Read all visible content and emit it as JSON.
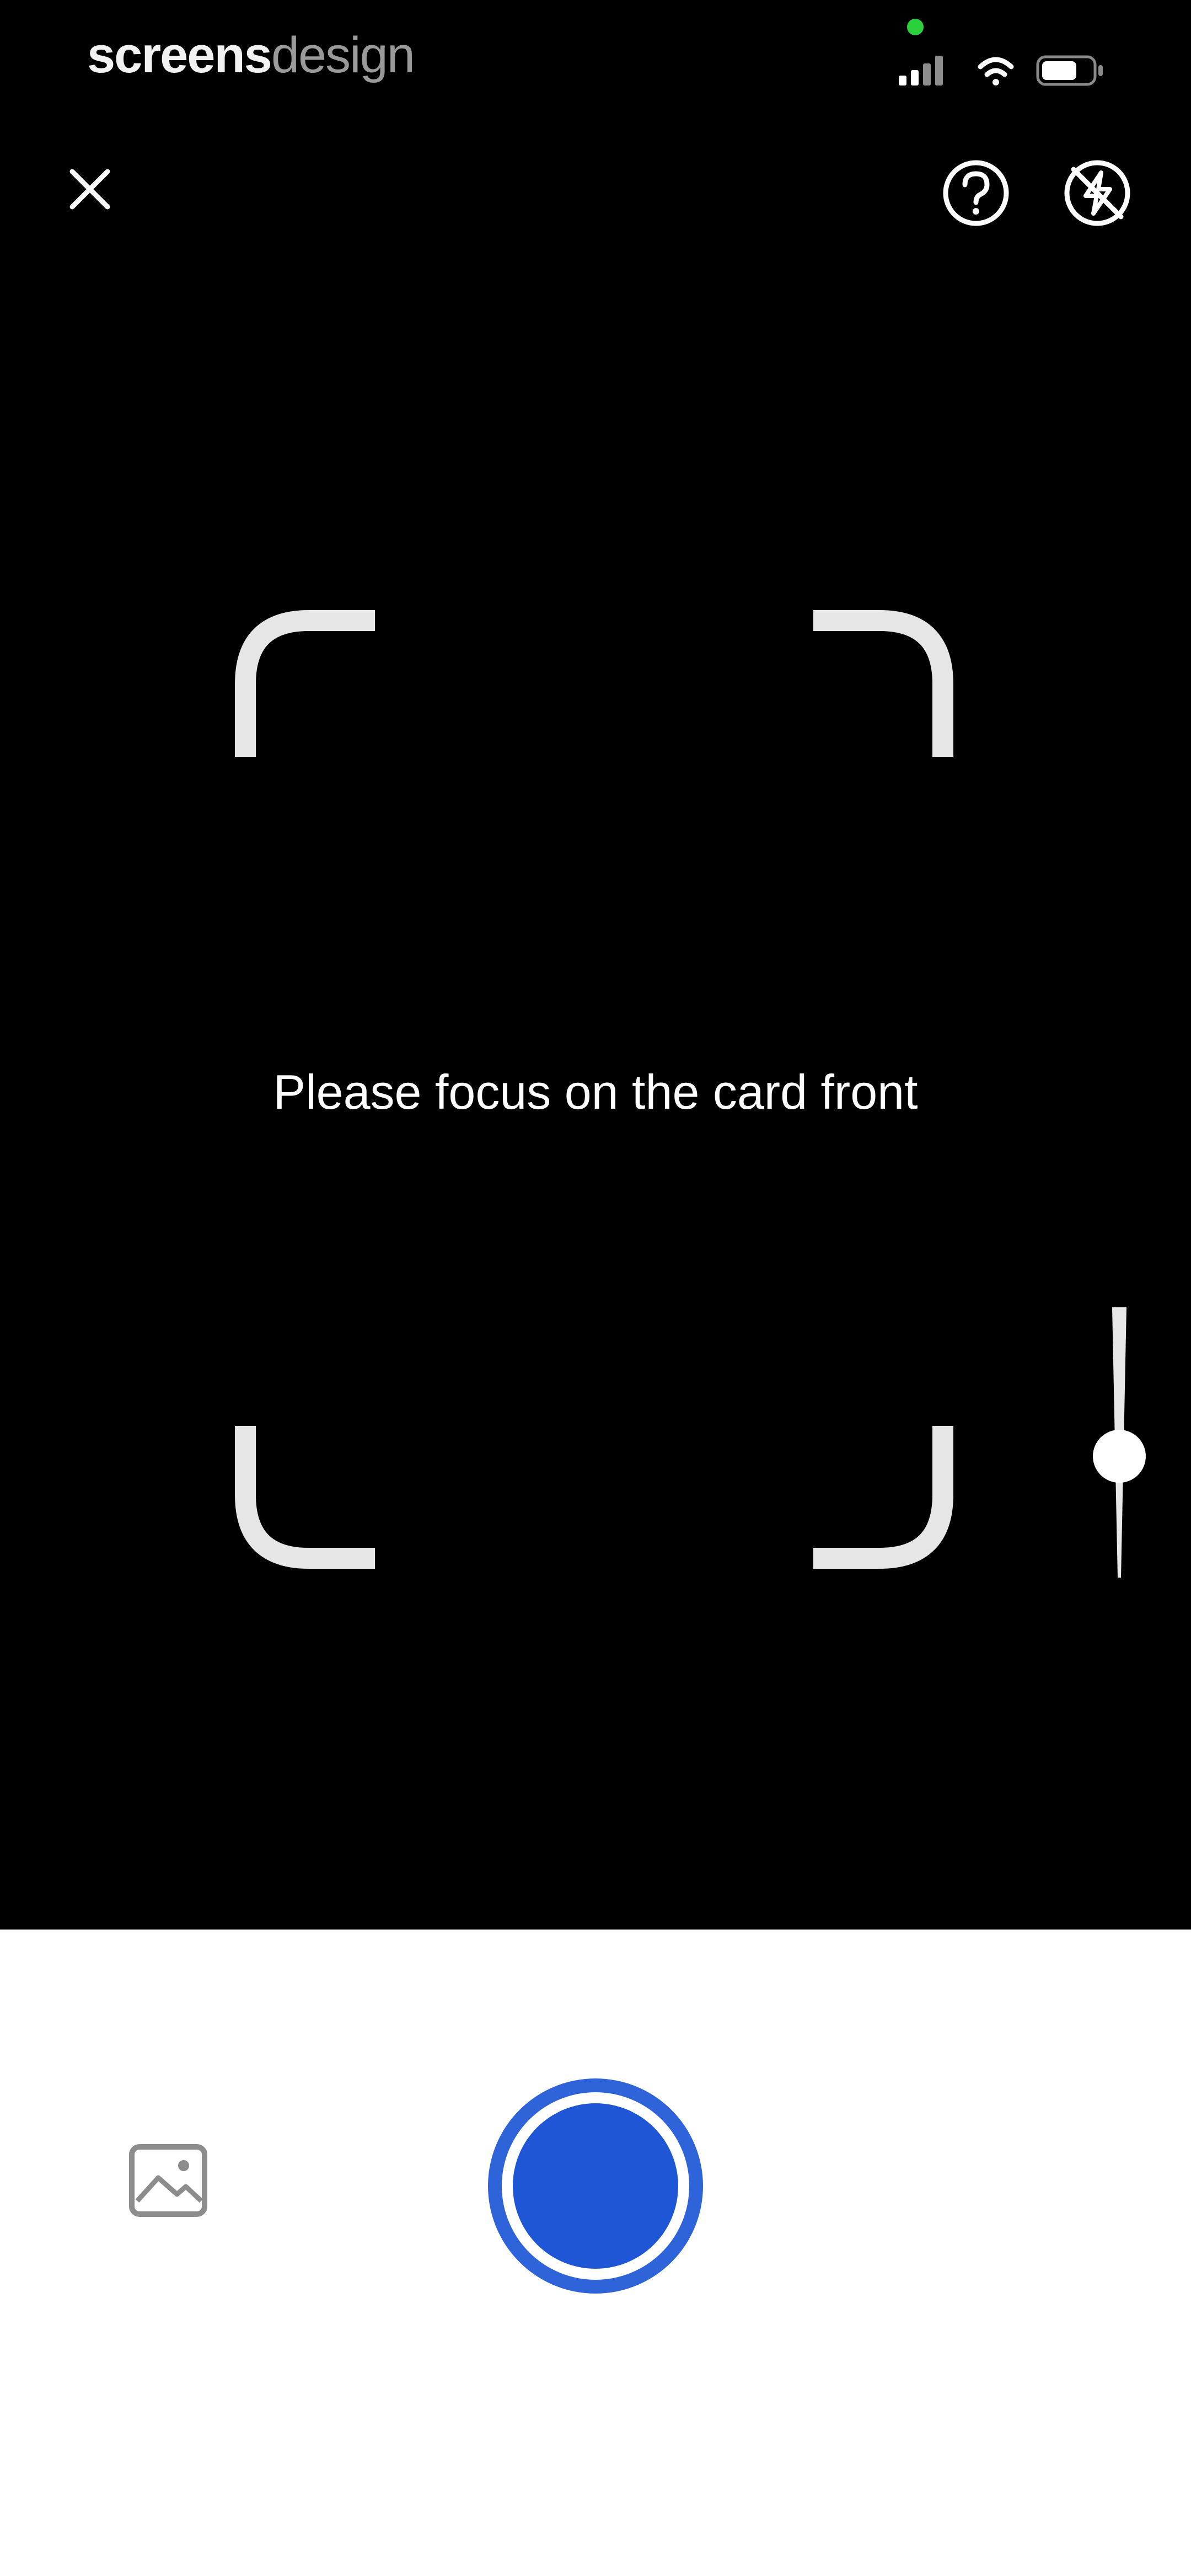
{
  "status_bar": {
    "brand_bold": "screens",
    "brand_light": "design",
    "icons": [
      "signal-icon",
      "wifi-icon",
      "battery-icon"
    ],
    "mic_indicator_color": "#2bd13c"
  },
  "top_controls": {
    "close_icon": "close-icon",
    "help_icon": "help-icon",
    "flash_icon": "flash-off-icon"
  },
  "viewfinder": {
    "instruction": "Please focus on the card front"
  },
  "zoom_slider": {
    "icon": "zoom-slider",
    "level": 0.5
  },
  "bottom_panel": {
    "gallery_icon": "gallery-icon",
    "shutter_icon": "shutter-button",
    "accent_color": "#1f56d6",
    "background_color": "#ffffff"
  }
}
